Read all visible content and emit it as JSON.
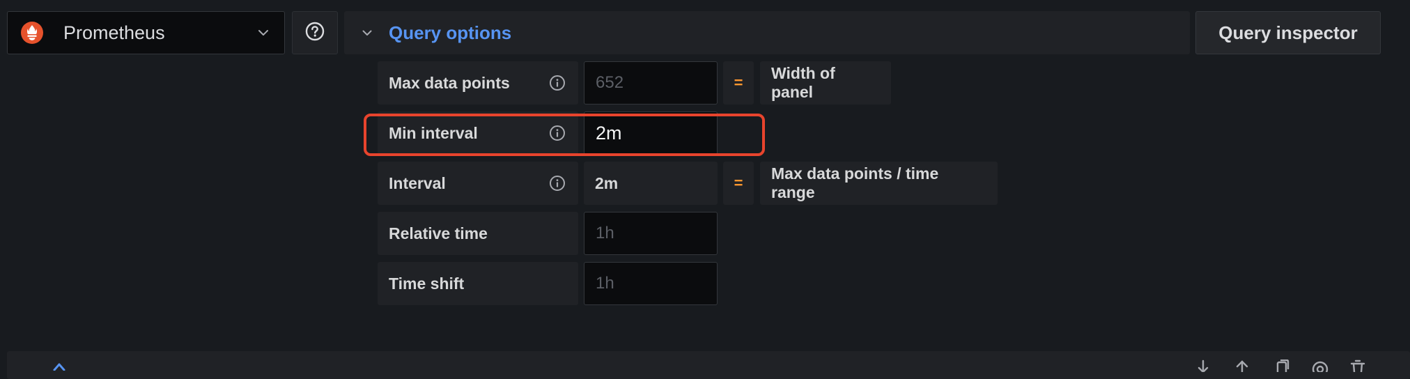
{
  "datasource": {
    "name": "Prometheus",
    "logo_icon": "prometheus-logo-icon",
    "logo_color": "#e6522c"
  },
  "help": {
    "icon": "question-circle-icon"
  },
  "query_options": {
    "title": "Query options",
    "accent": "#5794f2"
  },
  "query_inspector": {
    "label": "Query inspector"
  },
  "options": {
    "max_data_points": {
      "label": "Max data points",
      "placeholder": "652",
      "equals": "=",
      "description": "Width of panel"
    },
    "min_interval": {
      "label": "Min interval",
      "value": "2m"
    },
    "interval": {
      "label": "Interval",
      "value": "2m",
      "equals": "=",
      "description": "Max data points / time range"
    },
    "relative_time": {
      "label": "Relative time",
      "placeholder": "1h"
    },
    "time_shift": {
      "label": "Time shift",
      "placeholder": "1h"
    }
  },
  "highlight_color": "#e8442d"
}
